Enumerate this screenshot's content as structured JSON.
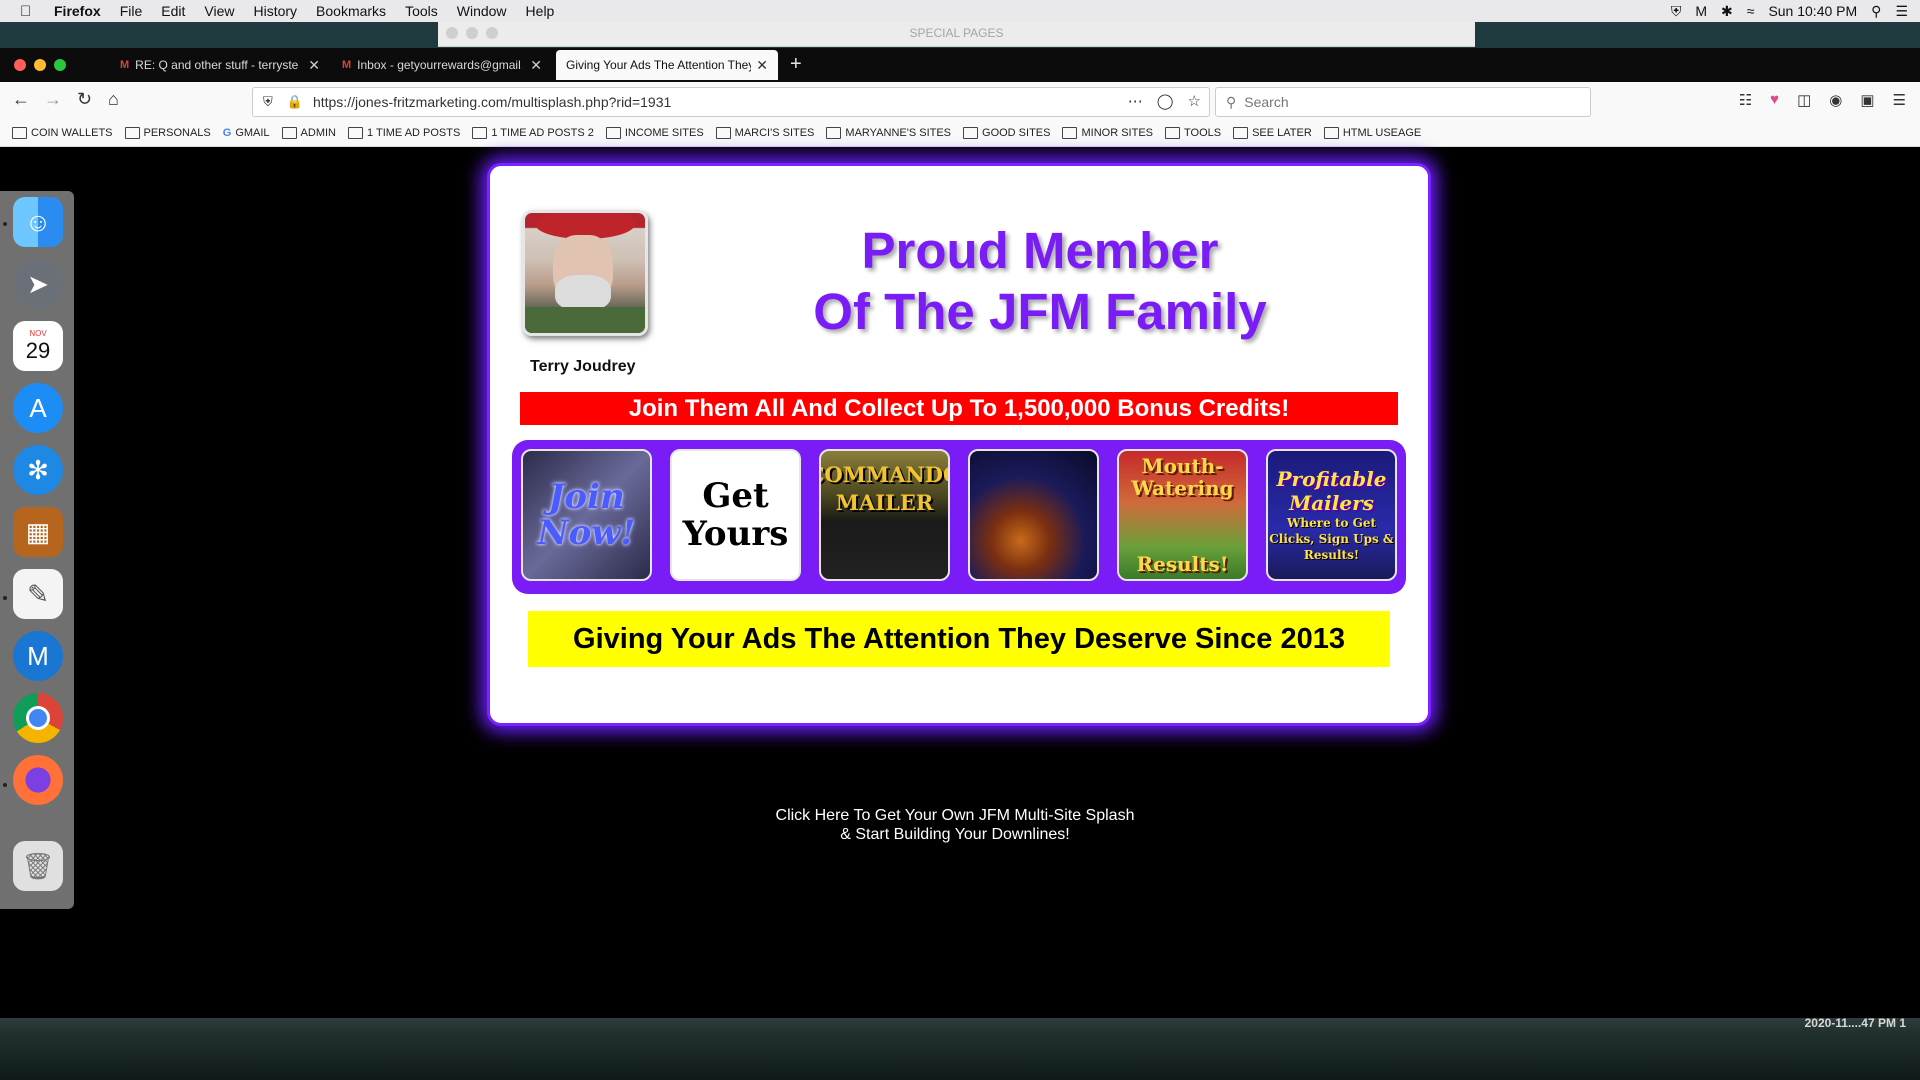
{
  "menubar": {
    "app_name": "Firefox",
    "items": [
      "File",
      "Edit",
      "View",
      "History",
      "Bookmarks",
      "Tools",
      "Window",
      "Help"
    ],
    "clock": "Sun 10:40 PM"
  },
  "special_window": {
    "title": "SPECIAL PAGES"
  },
  "tabs": [
    {
      "favicon": "M",
      "label": "RE: Q and other stuff - terryste",
      "active": false
    },
    {
      "favicon": "M",
      "label": "Inbox - getyourrewards@gmail.",
      "active": false
    },
    {
      "favicon": "",
      "label": "Giving Your Ads The Attention They",
      "active": true
    }
  ],
  "navbar": {
    "url": "https://jones-fritzmarketing.com/multisplash.php?rid=1931",
    "search_placeholder": "Search"
  },
  "bookmarks": [
    {
      "label": "COIN WALLETS",
      "icon": "folder"
    },
    {
      "label": "PERSONALS",
      "icon": "folder"
    },
    {
      "label": "GMAIL",
      "icon": "google"
    },
    {
      "label": "ADMIN",
      "icon": "folder"
    },
    {
      "label": "1 TIME AD POSTS",
      "icon": "folder"
    },
    {
      "label": "1 TIME AD POSTS 2",
      "icon": "folder"
    },
    {
      "label": "INCOME SITES",
      "icon": "folder"
    },
    {
      "label": "MARCI'S SITES",
      "icon": "folder"
    },
    {
      "label": "MARYANNE'S SITES",
      "icon": "folder"
    },
    {
      "label": "GOOD SITES",
      "icon": "folder"
    },
    {
      "label": "MINOR SITES",
      "icon": "folder"
    },
    {
      "label": "TOOLS",
      "icon": "folder"
    },
    {
      "label": "SEE LATER",
      "icon": "folder"
    },
    {
      "label": "HTML USEAGE",
      "icon": "folder"
    }
  ],
  "dock": {
    "calendar_month": "NOV",
    "calendar_day": "29",
    "apps": [
      "finder-icon",
      "launchpad-icon",
      "calendar-icon",
      "app-store-icon",
      "safari-icon",
      "calculator-icon",
      "textedit-icon",
      "mailbird-icon",
      "chrome-icon",
      "firefox-icon",
      "trash-icon"
    ]
  },
  "splash": {
    "member_name": "Terry Joudrey",
    "headline_line1": "Proud Member",
    "headline_line2": "Of The JFM Family",
    "red_banner": "Join Them All And Collect Up To 1,500,000 Bonus Credits!",
    "banners": {
      "b1": "Join Now!",
      "b2_line1": "Get",
      "b2_line2": "Yours",
      "b3_line1": "COMMANDO",
      "b3_line2": "MAILER",
      "b5_top": "Mouth-Watering",
      "b5_bottom": "Results!",
      "b6_title1": "Profitable",
      "b6_title2": "Mailers",
      "b6_sub": "Where to Get Clicks, Sign Ups & Results!"
    },
    "yellow_banner": "Giving Your Ads The Attention They Deserve Since 2013",
    "footer_line1": "Click Here To Get Your Own JFM Multi-Site Splash",
    "footer_line2": "& Start Building Your Downlines!"
  },
  "desktop_stamp": "2020-11....47 PM 1"
}
